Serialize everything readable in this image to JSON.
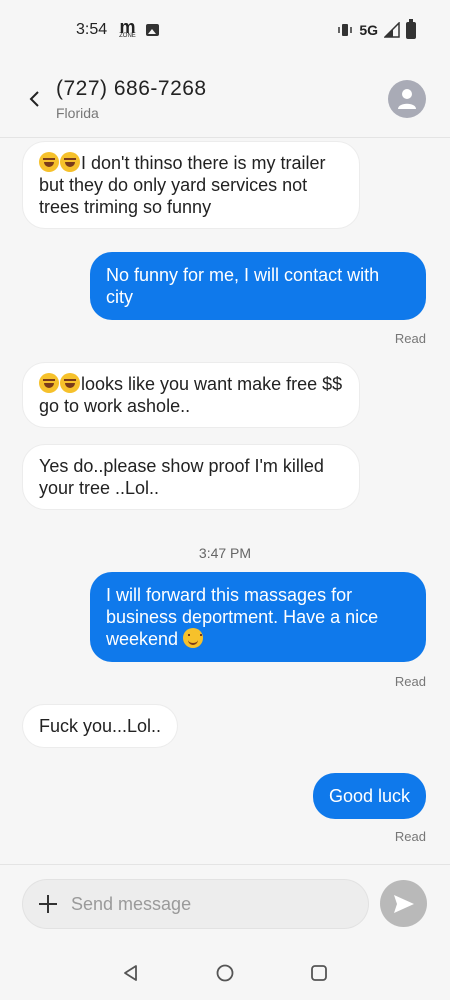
{
  "status_bar": {
    "time": "3:54",
    "carrier_logo": "m",
    "carrier_logo_sub": "ZONE",
    "network": "5G"
  },
  "header": {
    "contact_name": "(727) 686-7268",
    "contact_location": "Florida"
  },
  "messages": [
    {
      "direction": "incoming",
      "emoji": "rolling-on-floor-laughing x2",
      "text": "I don't  thinso there is my trailer but  they do only yard services not trees triming so funny"
    },
    {
      "direction": "outgoing",
      "text": "No funny for me, I will contact with city",
      "status": "Read"
    },
    {
      "direction": "incoming",
      "emoji": "rolling-on-floor-laughing x2",
      "text": "looks like you want make free $$ go to work ashole.."
    },
    {
      "direction": "incoming",
      "text": "Yes do..please show proof I'm  killed your tree ..Lol.."
    },
    {
      "direction": "timestamp",
      "text": "3:47 PM"
    },
    {
      "direction": "outgoing",
      "text": "I will forward this massages for business deportment. Have a nice weekend",
      "emoji": "smiling-face",
      "status": "Read"
    },
    {
      "direction": "incoming",
      "text": "Fuck you...Lol.."
    },
    {
      "direction": "outgoing",
      "text": "Good luck",
      "status": "Read"
    }
  ],
  "composer": {
    "placeholder": "Send message"
  },
  "colors": {
    "outgoing_bubble": "#0f79eb",
    "incoming_bubble": "#ffffff",
    "background": "#f6f6f6",
    "send_button": "#b9b9b9"
  },
  "icons": [
    "back-arrow-icon",
    "person-icon",
    "plus-icon",
    "send-icon",
    "nav-back-icon",
    "nav-home-icon",
    "nav-recents-icon"
  ]
}
